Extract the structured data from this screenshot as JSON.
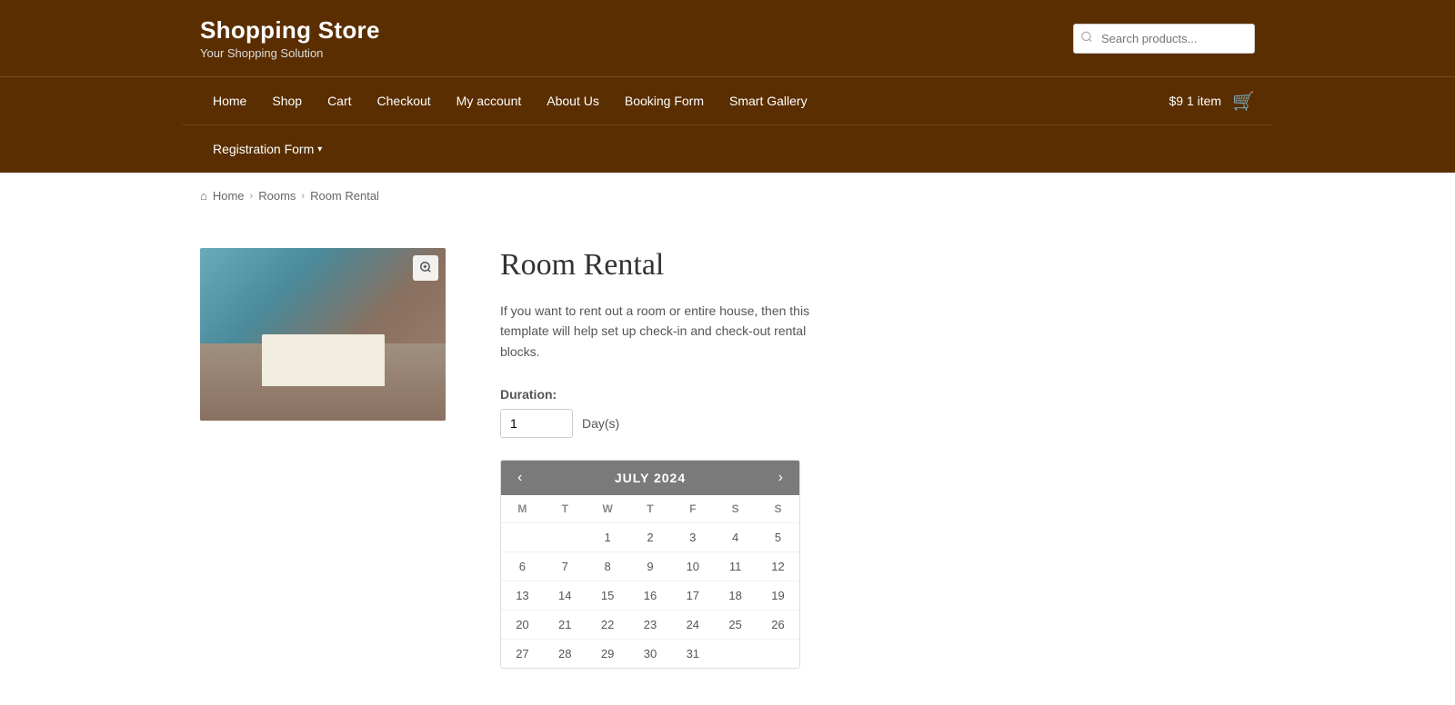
{
  "site": {
    "title": "Shopping Store",
    "tagline": "Your Shopping Solution"
  },
  "search": {
    "placeholder": "Search products..."
  },
  "nav": {
    "items": [
      {
        "label": "Home",
        "id": "home"
      },
      {
        "label": "Shop",
        "id": "shop"
      },
      {
        "label": "Cart",
        "id": "cart"
      },
      {
        "label": "Checkout",
        "id": "checkout"
      },
      {
        "label": "My account",
        "id": "my-account"
      },
      {
        "label": "About Us",
        "id": "about-us"
      },
      {
        "label": "Booking Form",
        "id": "booking-form"
      },
      {
        "label": "Smart Gallery",
        "id": "smart-gallery"
      }
    ],
    "second_row": [
      {
        "label": "Registration Form",
        "id": "registration-form",
        "has_dropdown": true
      }
    ],
    "cart": {
      "price": "$9",
      "item_count": "1 item"
    }
  },
  "breadcrumb": {
    "items": [
      {
        "label": "Home",
        "href": "#"
      },
      {
        "label": "Rooms",
        "href": "#"
      },
      {
        "label": "Room Rental",
        "href": null
      }
    ]
  },
  "product": {
    "title": "Room Rental",
    "description": "If you want to rent out a room or entire house, then this template will help set up check-in and check-out rental blocks.",
    "duration_label": "Duration:",
    "duration_value": "1",
    "duration_unit": "Day(s)",
    "zoom_icon": "🔍"
  },
  "calendar": {
    "month": "JULY 2024",
    "prev_label": "‹",
    "next_label": "›",
    "weekdays": [
      "M",
      "T",
      "W",
      "T",
      "F",
      "S",
      "S"
    ],
    "weeks": [
      [
        {
          "day": "",
          "empty": true
        },
        {
          "day": "",
          "empty": true
        },
        {
          "day": "1",
          "empty": false
        },
        {
          "day": "2",
          "empty": false
        },
        {
          "day": "3",
          "empty": false
        },
        {
          "day": "4",
          "empty": false
        },
        {
          "day": "5",
          "empty": false
        }
      ],
      [
        {
          "day": "6",
          "empty": false
        },
        {
          "day": "7",
          "empty": false
        },
        {
          "day": "8",
          "empty": false
        },
        {
          "day": "9",
          "empty": false
        },
        {
          "day": "10",
          "empty": false
        },
        {
          "day": "11",
          "empty": false
        },
        {
          "day": "12",
          "empty": false
        }
      ],
      [
        {
          "day": "13",
          "empty": false
        },
        {
          "day": "14",
          "empty": false
        },
        {
          "day": "15",
          "empty": false
        },
        {
          "day": "16",
          "empty": false
        },
        {
          "day": "17",
          "empty": false
        },
        {
          "day": "18",
          "empty": false
        },
        {
          "day": "19",
          "empty": false
        }
      ],
      [
        {
          "day": "20",
          "empty": false
        },
        {
          "day": "21",
          "empty": false
        },
        {
          "day": "22",
          "empty": false
        },
        {
          "day": "23",
          "empty": false
        },
        {
          "day": "24",
          "empty": false
        },
        {
          "day": "25",
          "empty": false
        },
        {
          "day": "26",
          "empty": false
        }
      ],
      [
        {
          "day": "27",
          "empty": false
        },
        {
          "day": "28",
          "empty": false
        },
        {
          "day": "29",
          "empty": false
        },
        {
          "day": "30",
          "empty": false
        },
        {
          "day": "31",
          "empty": false
        },
        {
          "day": "",
          "empty": true
        },
        {
          "day": "",
          "empty": true
        }
      ]
    ]
  }
}
